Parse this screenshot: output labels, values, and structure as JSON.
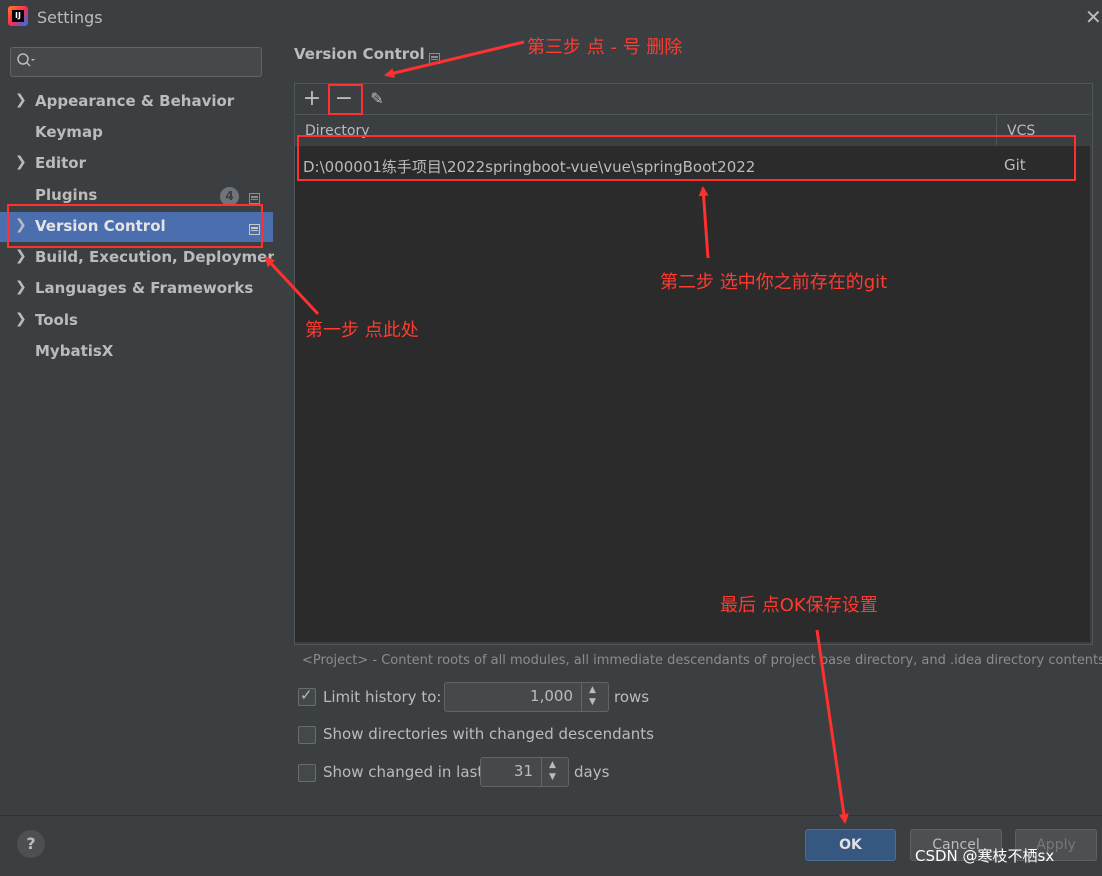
{
  "window": {
    "title": "Settings",
    "logo_text": "IJ"
  },
  "sidebar": {
    "search_placeholder": "",
    "items": [
      {
        "label": "Appearance & Behavior",
        "expandable": true
      },
      {
        "label": "Keymap",
        "expandable": false
      },
      {
        "label": "Editor",
        "expandable": true
      },
      {
        "label": "Plugins",
        "expandable": false,
        "badge": "4"
      },
      {
        "label": "Version Control",
        "expandable": true,
        "selected": true
      },
      {
        "label": "Build, Execution, Deployment",
        "expandable": true
      },
      {
        "label": "Languages & Frameworks",
        "expandable": true
      },
      {
        "label": "Tools",
        "expandable": true
      },
      {
        "label": "MybatisX",
        "expandable": false
      }
    ]
  },
  "main": {
    "title": "Version Control",
    "table": {
      "columns": [
        "Directory",
        "VCS"
      ],
      "rows": [
        {
          "directory": "D:\\000001练手项目\\2022springboot-vue\\vue\\springBoot2022",
          "vcs": "Git"
        }
      ]
    },
    "hint": "<Project> - Content roots of all modules, all immediate descendants of project base directory, and .idea directory contents",
    "options": {
      "limit_history_label": "Limit history to:",
      "limit_history_checked": true,
      "limit_history_value": "1,000",
      "limit_history_suffix": "rows",
      "show_dirs_label": "Show directories with changed descendants",
      "show_dirs_checked": false,
      "show_changed_label": "Show changed in last",
      "show_changed_checked": false,
      "show_changed_value": "31",
      "show_changed_suffix": "days"
    }
  },
  "footer": {
    "help": "?",
    "ok": "OK",
    "cancel": "Cancel",
    "apply": "Apply"
  },
  "annotations": {
    "step1": "第一步 点此处",
    "step2": "第二步 选中你之前存在的git",
    "step3": "第三步  点 - 号 删除",
    "final": "最后  点OK保存设置"
  },
  "watermark": "CSDN @寒枝不栖sx",
  "colors": {
    "accent": "#4b6eaf",
    "annotation": "#ff3030",
    "ok_button": "#365880"
  }
}
